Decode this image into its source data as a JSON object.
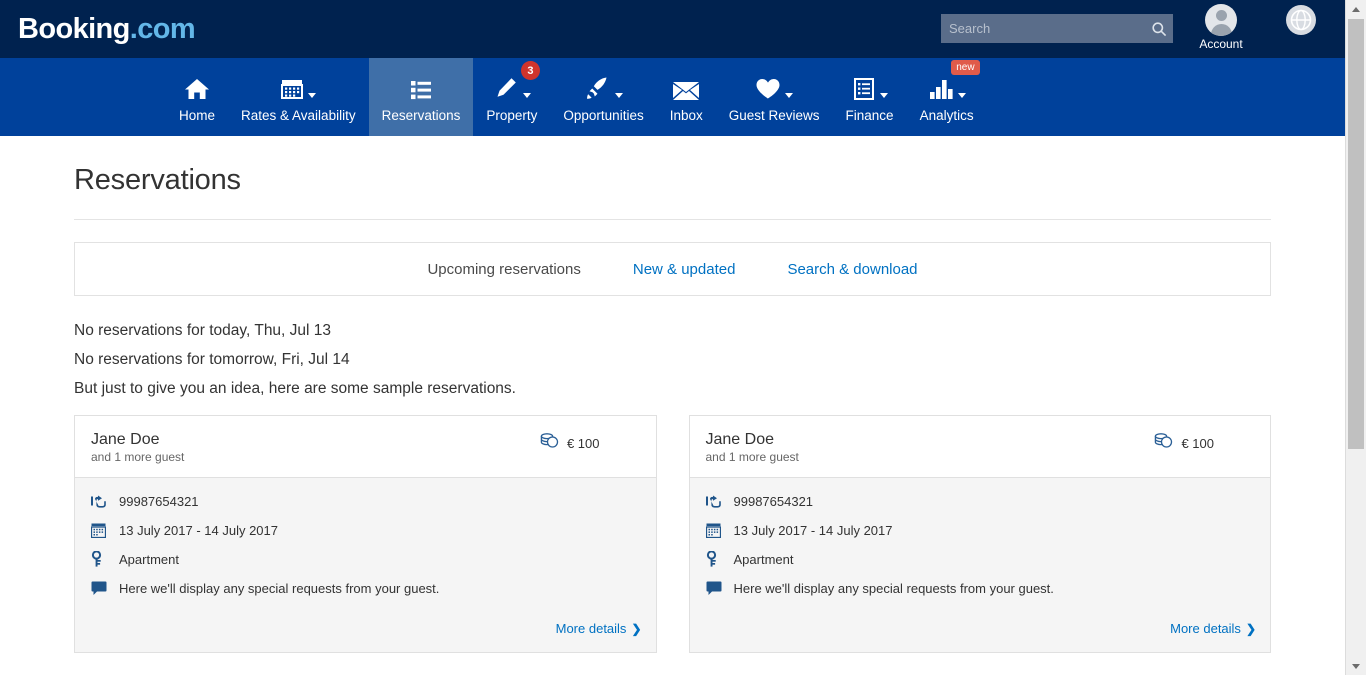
{
  "header": {
    "logo_brand": "Booking",
    "logo_tld": ".com",
    "search": {
      "placeholder": "Search",
      "value": "",
      "icon": "search-icon"
    },
    "account": {
      "label": "Account",
      "icon": "account-avatar-icon"
    },
    "language": {
      "icon": "globe-icon"
    },
    "colors": {
      "header_bg": "#00224f",
      "nav_bg": "#00419b",
      "active_tab_bg": "#3f6fa8",
      "badge_red": "#d0342c",
      "link_blue": "#0071c2"
    }
  },
  "nav": {
    "items": [
      {
        "label": "Home",
        "icon": "home-icon",
        "caret": false,
        "active": false,
        "badge": ""
      },
      {
        "label": "Rates & Availability",
        "icon": "calendar-icon",
        "caret": true,
        "active": false,
        "badge": ""
      },
      {
        "label": "Reservations",
        "icon": "list-icon",
        "caret": false,
        "active": true,
        "badge": ""
      },
      {
        "label": "Property",
        "icon": "pencil-icon",
        "caret": true,
        "active": false,
        "badge": "3"
      },
      {
        "label": "Opportunities",
        "icon": "rocket-icon",
        "caret": true,
        "active": false,
        "badge": ""
      },
      {
        "label": "Inbox",
        "icon": "envelope-icon",
        "caret": false,
        "active": false,
        "badge": ""
      },
      {
        "label": "Guest Reviews",
        "icon": "heart-icon",
        "caret": true,
        "active": false,
        "badge": ""
      },
      {
        "label": "Finance",
        "icon": "document-list-icon",
        "caret": true,
        "active": false,
        "badge": ""
      },
      {
        "label": "Analytics",
        "icon": "bar-chart-icon",
        "caret": true,
        "active": false,
        "badge": "new"
      }
    ]
  },
  "page": {
    "title": "Reservations",
    "tabs": [
      {
        "label": "Upcoming reservations",
        "active": true
      },
      {
        "label": "New & updated",
        "active": false
      },
      {
        "label": "Search & download",
        "active": false
      }
    ],
    "notices": [
      "No reservations for today, Thu, Jul 13",
      "No reservations for tomorrow, Fri, Jul 14",
      "But just to give you an idea, here are some sample reservations."
    ]
  },
  "reservations": [
    {
      "guest_name": "Jane Doe",
      "guest_sub": "and 1 more guest",
      "price": "€ 100",
      "price_icon": "coins-icon",
      "booking_number": "99987654321",
      "booking_number_icon": "check-in-hand-icon",
      "dates": "13 July 2017 - 14 July 2017",
      "dates_icon": "calendar-icon",
      "room_type": "Apartment",
      "room_type_icon": "key-icon",
      "special_requests": "Here we'll display any special requests from your guest.",
      "special_requests_icon": "speech-bubble-icon",
      "more_details_label": "More details",
      "more_details_icon": "chevron-right-icon"
    },
    {
      "guest_name": "Jane Doe",
      "guest_sub": "and 1 more guest",
      "price": "€ 100",
      "price_icon": "coins-icon",
      "booking_number": "99987654321",
      "booking_number_icon": "check-in-hand-icon",
      "dates": "13 July 2017 - 14 July 2017",
      "dates_icon": "calendar-icon",
      "room_type": "Apartment",
      "room_type_icon": "key-icon",
      "special_requests": "Here we'll display any special requests from your guest.",
      "special_requests_icon": "speech-bubble-icon",
      "more_details_label": "More details",
      "more_details_icon": "chevron-right-icon"
    }
  ]
}
